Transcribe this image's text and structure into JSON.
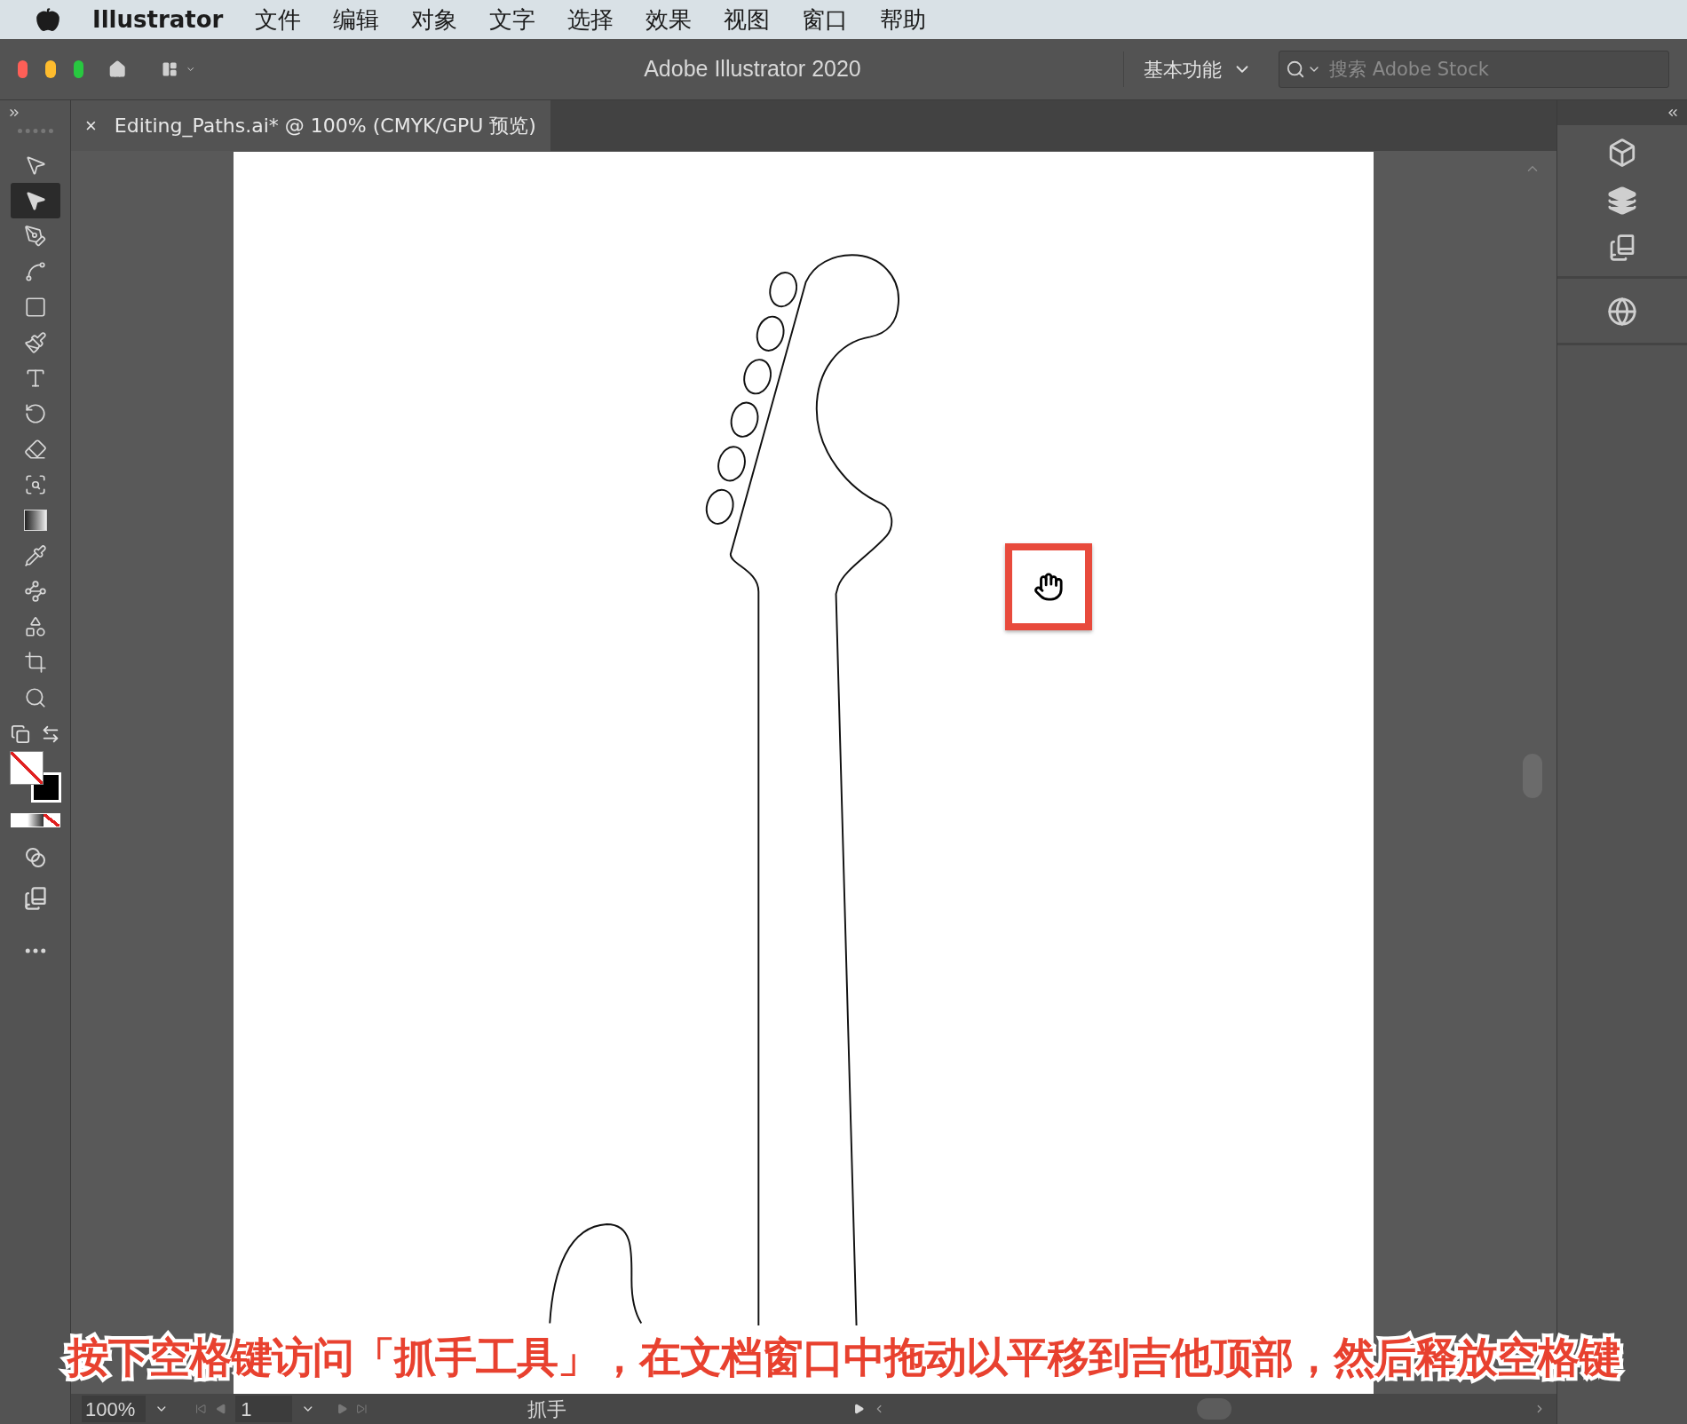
{
  "menu_bar": {
    "app_name": "Illustrator",
    "items": [
      "文件",
      "编辑",
      "对象",
      "文字",
      "选择",
      "效果",
      "视图",
      "窗口",
      "帮助"
    ]
  },
  "title_bar": {
    "title": "Adobe Illustrator 2020",
    "workspace": "基本功能",
    "search": {
      "placeholder": "搜索 Adobe Stock"
    }
  },
  "document_tab": {
    "close": "×",
    "label": "Editing_Paths.ai* @ 100% (CMYK/GPU 预览)",
    "selected": true
  },
  "tools": [
    {
      "selected": false
    },
    {
      "selected": true
    },
    {
      "selected": false
    },
    {
      "selected": false
    },
    {
      "selected": false
    },
    {
      "selected": false
    },
    {
      "selected": false
    },
    {
      "selected": false
    },
    {
      "selected": false
    },
    {
      "selected": false
    },
    {
      "selected": false
    },
    {
      "selected": false
    },
    {
      "selected": false
    },
    {
      "selected": false
    },
    {
      "selected": false
    },
    {
      "selected": false
    }
  ],
  "status_bar": {
    "zoom": "100%",
    "artboard": "1",
    "tool": "抓手"
  },
  "caption": "按下空格键访问「抓手工具」，在文档窗口中拖动以平移到吉他顶部，然后释放空格键"
}
